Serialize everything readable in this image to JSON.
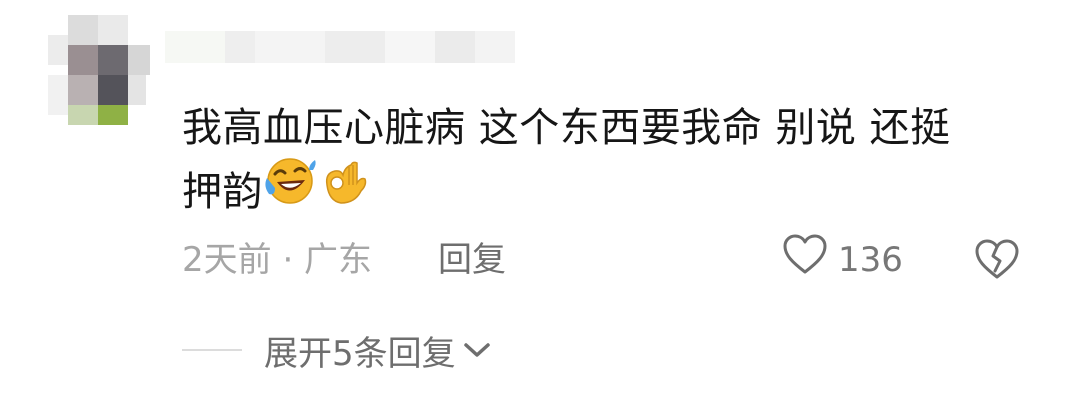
{
  "comment": {
    "line1": "我高血压心脏病 这个东西要我命 别说 还挺",
    "line2": "押韵",
    "emojis": [
      "rofl-emoji",
      "ok-hand-emoji"
    ]
  },
  "meta": {
    "time_location": "2天前 · 广东",
    "reply_label": "回复"
  },
  "likes": {
    "count": "136"
  },
  "expand": {
    "label": "展开5条回复"
  },
  "colors": {
    "text": "#161616",
    "meta": "#a6a6a6",
    "secondary": "#6e6e6e",
    "emoji_yellow": "#f6b82b",
    "tear_blue": "#4fa3e8"
  }
}
